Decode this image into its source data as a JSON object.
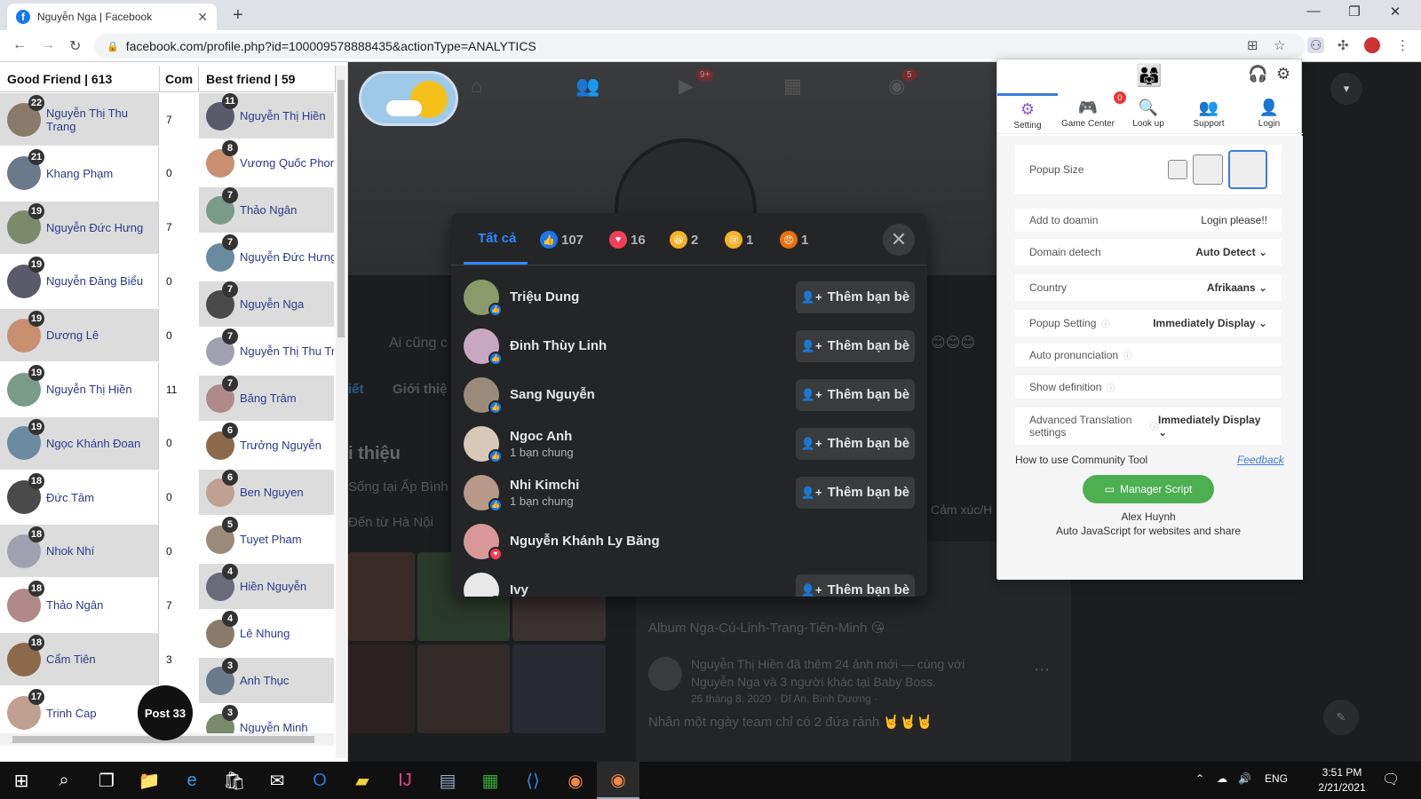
{
  "browser": {
    "tab_title": "Nguyễn Nga | Facebook",
    "url": "facebook.com/profile.php?id=100009578888435&actionType=ANALYTICS"
  },
  "left_panel": {
    "header_good": "Good Friend | 613",
    "header_com": "Com",
    "header_best": "Best friend | 59",
    "good_friends": [
      {
        "badge": "22",
        "name": "Nguyễn Thị Thu Trang",
        "com": "7"
      },
      {
        "badge": "21",
        "name": "Khang Phạm",
        "com": "0"
      },
      {
        "badge": "19",
        "name": "Nguyễn Đức Hưng",
        "com": "7"
      },
      {
        "badge": "19",
        "name": "Nguyễn Đăng Biểu",
        "com": "0"
      },
      {
        "badge": "19",
        "name": "Dương Lê",
        "com": "0"
      },
      {
        "badge": "19",
        "name": "Nguyễn Thị Hiền",
        "com": "11"
      },
      {
        "badge": "19",
        "name": "Ngọc Khánh Đoan",
        "com": "0"
      },
      {
        "badge": "18",
        "name": "Đức Tâm",
        "com": "0"
      },
      {
        "badge": "18",
        "name": "Nhok Nhí",
        "com": "0"
      },
      {
        "badge": "18",
        "name": "Thảo Ngân",
        "com": "7"
      },
      {
        "badge": "18",
        "name": "Cẩm Tiên",
        "com": "3"
      },
      {
        "badge": "17",
        "name": "Trinh Cap",
        "com": ""
      }
    ],
    "best_friends": [
      {
        "badge": "11",
        "name": "Nguyễn Thị Hiền"
      },
      {
        "badge": "8",
        "name": "Vương Quốc Phong"
      },
      {
        "badge": "7",
        "name": "Thảo Ngân"
      },
      {
        "badge": "7",
        "name": "Nguyễn Đức Hưng"
      },
      {
        "badge": "7",
        "name": "Nguyễn Nga"
      },
      {
        "badge": "7",
        "name": "Nguyễn Thị Thu Trang"
      },
      {
        "badge": "7",
        "name": "Băng Trâm"
      },
      {
        "badge": "6",
        "name": "Trưởng Nguyễn"
      },
      {
        "badge": "6",
        "name": "Ben Nguyen"
      },
      {
        "badge": "5",
        "name": "Tuyet Pham"
      },
      {
        "badge": "4",
        "name": "Hiền Nguyễn"
      },
      {
        "badge": "4",
        "name": "Lê Nhung"
      },
      {
        "badge": "3",
        "name": "Anh Thục"
      },
      {
        "badge": "3",
        "name": "Nguyễn Minh"
      }
    ],
    "post_button": "Post 33"
  },
  "fb_background": {
    "nav_badge_watch": "9+",
    "nav_badge_groups": "5",
    "intro_title": "i thiệu",
    "lives_in": "Sống tại Ấp Bình",
    "from": "Đến từ Hà Nội",
    "tab_about": "iết",
    "tab_intro": "Giới thiệ",
    "composer": "Ai cũng c",
    "feeling": "Cảm xúc/H",
    "album_line": "Album Nga-Cú-Linh-Trang-Tiên-Minh 😘",
    "post_author_line": "Nguyễn Thị Hiền đã thêm 24 ảnh mới — cùng với",
    "post_with_line": "Nguyễn Nga và 3 người khác tại Baby Boss.",
    "post_date": "26 tháng 8, 2020 · Dĩ An, Bình Dương · ",
    "post_text": "Nhân một ngày team chỉ có 2 đứa rảnh 🤘🤘🤘"
  },
  "reactions_modal": {
    "tabs": [
      {
        "label": "Tất cả",
        "icon": ""
      },
      {
        "label": "107",
        "icon": "like"
      },
      {
        "label": "16",
        "icon": "love"
      },
      {
        "label": "2",
        "icon": "haha"
      },
      {
        "label": "1",
        "icon": "sad"
      },
      {
        "label": "1",
        "icon": "angry"
      }
    ],
    "people": [
      {
        "name": "Triệu Dung",
        "sub": "",
        "reaction": "like",
        "button": "Thêm bạn bè",
        "color": "#8a9a6a"
      },
      {
        "name": "Đinh Thùy Linh",
        "sub": "",
        "reaction": "like",
        "button": "Thêm bạn bè",
        "color": "#c8a8c0"
      },
      {
        "name": "Sang Nguyễn",
        "sub": "",
        "reaction": "like",
        "button": "Thêm bạn bè",
        "color": "#9a8a7a"
      },
      {
        "name": "Ngoc Anh",
        "sub": "1 bạn chung",
        "reaction": "like",
        "button": "Thêm bạn bè",
        "color": "#d8c8b8"
      },
      {
        "name": "Nhi Kimchi",
        "sub": "1 bạn chung",
        "reaction": "like",
        "button": "Thêm bạn bè",
        "color": "#b89888"
      },
      {
        "name": "Nguyễn Khánh Ly Băng",
        "sub": "",
        "reaction": "love",
        "button": "",
        "color": "#d89898"
      },
      {
        "name": "Ivy",
        "sub": "",
        "reaction": "like",
        "button": "Thêm bạn bè",
        "color": "#e8e8e8"
      }
    ]
  },
  "extension": {
    "tabs": [
      {
        "label": "Setting",
        "icon": "⚙"
      },
      {
        "label": "Game Center",
        "icon": "🎮",
        "badge": "0"
      },
      {
        "label": "Look up",
        "icon": "🔍"
      },
      {
        "label": "Support",
        "icon": "👥"
      },
      {
        "label": "Login",
        "icon": "👤"
      }
    ],
    "popup_size_label": "Popup Size",
    "add_domain_label": "Add to doamin",
    "add_domain_value": "Login please!!",
    "domain_label": "Domain detech",
    "domain_value": "Auto Detect",
    "country_label": "Country",
    "country_value": "Afrikaans",
    "popup_setting_label": "Popup Setting",
    "popup_setting_value": "Immediately Display",
    "auto_pron_label": "Auto pronunciation",
    "show_def_label": "Show definition",
    "adv_label": "Advanced Translation settings",
    "adv_value": "Immediately Display",
    "howto": "How to use Community Tool",
    "feedback": "Feedback",
    "manager_script": "Manager Script",
    "author": "Alex Huynh",
    "tagline": "Auto JavaScript for websites and share"
  },
  "taskbar": {
    "lang": "ENG",
    "time": "3:51 PM",
    "date": "2/21/2021"
  }
}
